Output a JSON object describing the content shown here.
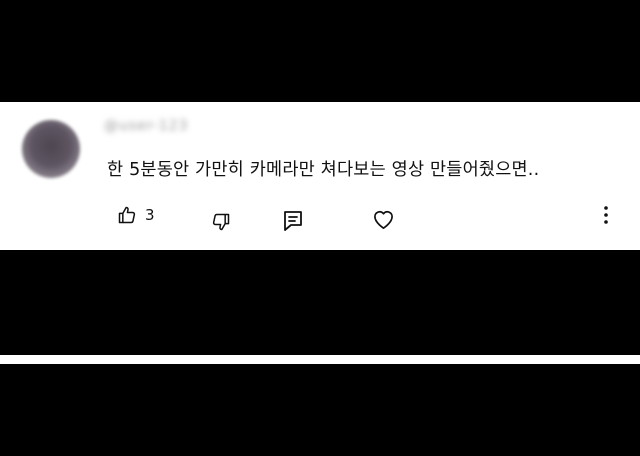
{
  "comment": {
    "username": "@user-123",
    "text": "한 5분동안 가만히 카메라만 쳐다보는 영상 만들어줬으면..",
    "like_count": "3"
  },
  "icons": {
    "like": "thumbs-up-icon",
    "dislike": "thumbs-down-icon",
    "reply": "reply-icon",
    "heart": "heart-icon",
    "more": "more-vertical-icon"
  },
  "colors": {
    "background": "#000000",
    "card": "#ffffff",
    "text": "#111111"
  }
}
